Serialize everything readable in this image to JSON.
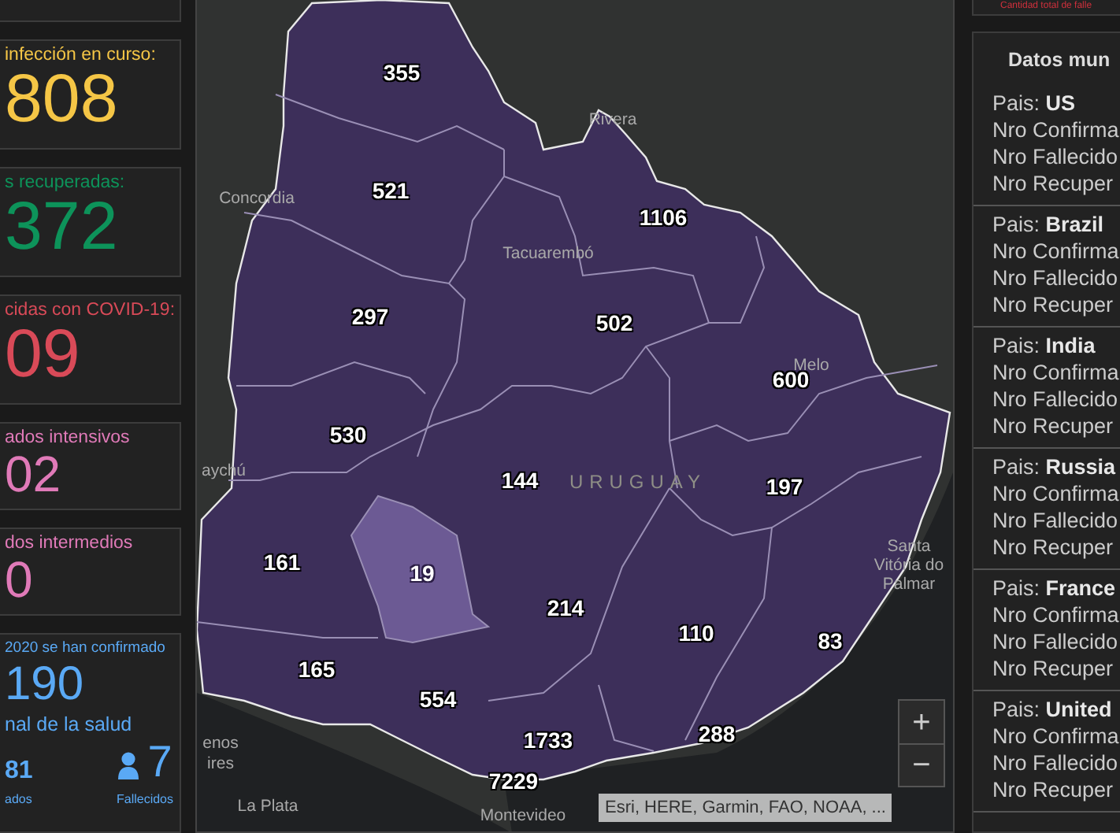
{
  "left_cards": [
    {
      "kind": "large",
      "label": "infección en curso:",
      "value": "808",
      "color": "#f5c646"
    },
    {
      "kind": "large",
      "label": "s recuperadas:",
      "value": "372",
      "color": "#0d935a"
    },
    {
      "kind": "large",
      "label": "cidas con COVID-19:",
      "value": "09",
      "color": "#d94a58"
    },
    {
      "kind": "medium",
      "label": "ados intensivos",
      "value": "02",
      "color": "#e07ab8"
    },
    {
      "kind": "medium",
      "label": "dos intermedios",
      "value": "0",
      "color": "#e07ab8"
    },
    {
      "kind": "summary",
      "label": "2020 se han confirmado",
      "value": "190",
      "subtitle": "nal de la salud",
      "left_value": "81",
      "left_caption": "ados",
      "right_value": "7",
      "right_caption": "Fallecidos",
      "color": "#5aa9f5"
    }
  ],
  "map": {
    "departments": [
      {
        "count": "355",
        "selected": false
      },
      {
        "count": "521",
        "selected": false
      },
      {
        "count": "1106",
        "selected": false
      },
      {
        "count": "297",
        "selected": false
      },
      {
        "count": "502",
        "selected": false
      },
      {
        "count": "600",
        "selected": false
      },
      {
        "count": "530",
        "selected": false
      },
      {
        "count": "144",
        "selected": false
      },
      {
        "count": "197",
        "selected": false
      },
      {
        "count": "161",
        "selected": false
      },
      {
        "count": "19",
        "selected": true
      },
      {
        "count": "214",
        "selected": false
      },
      {
        "count": "110",
        "selected": false
      },
      {
        "count": "83",
        "selected": false
      },
      {
        "count": "165",
        "selected": false
      },
      {
        "count": "554",
        "selected": false
      },
      {
        "count": "1733",
        "selected": false
      },
      {
        "count": "288",
        "selected": false
      },
      {
        "count": "7229",
        "selected": false
      }
    ],
    "places": [
      "Rivera",
      "Concordia",
      "Tacuarembó",
      "Melo",
      "aychú",
      "Santa",
      "Vitória do",
      "Palmar",
      "enos",
      "ires",
      "La Plata",
      "Montevideo"
    ],
    "country_label": "URUGUAY",
    "attribution": "Esri, HERE, Garmin, FAO, NOAA, ...",
    "zoom_in": "+",
    "zoom_out": "−"
  },
  "world_panel": {
    "top_note": "Cantidad total de falle",
    "title": "Datos mun",
    "countries": [
      {
        "label": "Pais:",
        "country": "US",
        "lines": [
          "Nro Confirma",
          "Nro Fallecido",
          "Nro Recuper"
        ]
      },
      {
        "label": "Pais:",
        "country": "Brazil",
        "lines": [
          "Nro Confirma",
          "Nro Fallecido",
          "Nro Recuper"
        ]
      },
      {
        "label": "Pais:",
        "country": "India",
        "lines": [
          "Nro Confirma",
          "Nro Fallecido",
          "Nro Recuper"
        ]
      },
      {
        "label": "Pais:",
        "country": "Russia",
        "lines": [
          "Nro Confirma",
          "Nro Fallecido",
          "Nro Recuper"
        ]
      },
      {
        "label": "Pais:",
        "country": "France",
        "lines": [
          "Nro Confirma",
          "Nro Fallecido",
          "Nro Recuper"
        ]
      },
      {
        "label": "Pais:",
        "country": "United",
        "lines": [
          "Nro Confirma",
          "Nro Fallecido",
          "Nro Recuper"
        ]
      }
    ]
  }
}
